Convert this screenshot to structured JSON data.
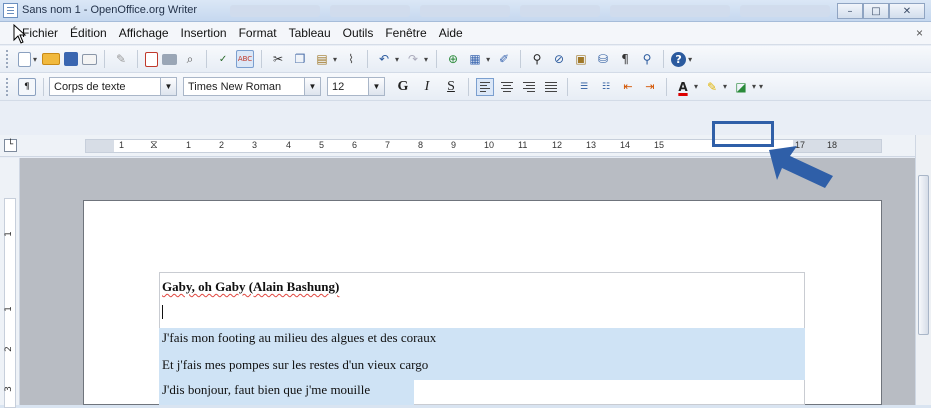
{
  "window": {
    "title": "Sans nom 1 - OpenOffice.org Writer",
    "controls": {
      "minimize": "–",
      "maximize": "□",
      "close": "✕"
    }
  },
  "menubar": {
    "items": [
      "Fichier",
      "Édition",
      "Affichage",
      "Insertion",
      "Format",
      "Tableau",
      "Outils",
      "Fenêtre",
      "Aide"
    ],
    "close_doc": "×"
  },
  "formatting": {
    "paragraph_style": "Corps de texte",
    "font_name": "Times New Roman",
    "font_size": "12",
    "bold": "G",
    "italic": "I",
    "underline": "S"
  },
  "ruler": {
    "numbers": [
      "1",
      "1",
      "2",
      "3",
      "4",
      "5",
      "6",
      "7",
      "8",
      "9",
      "10",
      "11",
      "12",
      "13",
      "14",
      "15",
      "17",
      "18"
    ]
  },
  "vertical_ruler": [
    "1",
    "1",
    "2",
    "3"
  ],
  "document": {
    "heading": "Gaby, oh Gaby (Alain Bashung)",
    "lines": [
      "J'fais mon footing au milieu des algues et des coraux",
      "Et j'fais mes pompes sur les restes d'un vieux cargo",
      "J'dis bonjour, faut bien que j'me mouille"
    ]
  },
  "colors": {
    "highlight_box": "#2f5fa8",
    "arrow": "#2f5fa8",
    "selection": "#cfe3f5"
  },
  "icons": [
    "new-doc-icon",
    "open-icon",
    "save-icon",
    "email-icon",
    "edit-icon",
    "export-pdf-icon",
    "print-icon",
    "print-preview-icon",
    "spellcheck-icon",
    "autospell-icon",
    "cut-icon",
    "copy-icon",
    "paste-icon",
    "clone-format-icon",
    "undo-icon",
    "redo-icon",
    "hyperlink-icon",
    "table-icon",
    "draw-icon",
    "find-icon",
    "navigator-icon",
    "gallery-icon",
    "datasource-icon",
    "formatting-marks-icon",
    "zoom-icon",
    "help-icon",
    "styles-icon",
    "decrease-indent-icon",
    "increase-indent-icon",
    "font-color-icon",
    "highlight-icon",
    "background-color-icon"
  ]
}
